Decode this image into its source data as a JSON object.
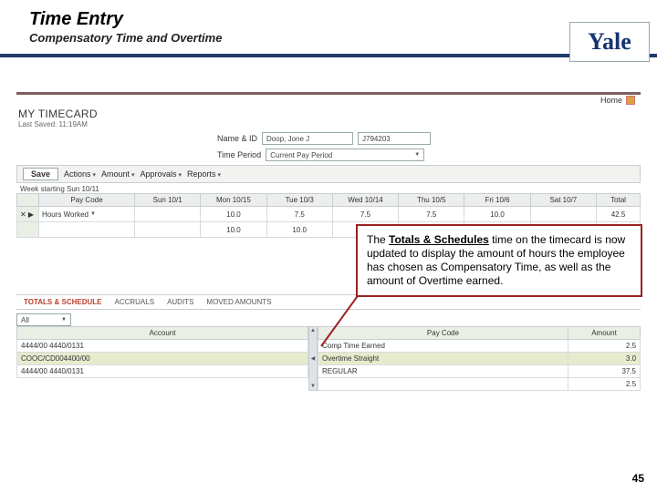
{
  "header": {
    "title": "Time Entry",
    "subtitle": "Compensatory Time and Overtime"
  },
  "brand": {
    "label": "Yale"
  },
  "corner": {
    "home": "Home"
  },
  "myTimecard": {
    "title": "MY TIMECARD",
    "saved": "Last Saved: 11:19AM"
  },
  "meta": {
    "nameLbl": "Name & ID",
    "nameVal": "Doop, Jone J",
    "idVal": "J794203",
    "periodLbl": "Time Period",
    "periodVal": "Current Pay Period"
  },
  "toolbar": {
    "save": "Save",
    "menus": [
      "Actions",
      "Amount",
      "Approvals",
      "Reports"
    ]
  },
  "week": {
    "label": "Week starting Sun 10/11"
  },
  "grid": {
    "cols": [
      "Pay Code",
      "Sun 10/1",
      "Mon 10/15",
      "Tue 10/3",
      "Wed 10/14",
      "Thu 10/5",
      "Fri 10/6",
      "Sat 10/7",
      "Total"
    ],
    "row1": [
      "Hours Worked",
      "",
      "10.0",
      "7.5",
      "7.5",
      "7.5",
      "10.0",
      "",
      "42.5"
    ],
    "row2": [
      "",
      "",
      "10.0",
      "10.0",
      "",
      "",
      "",
      "",
      ""
    ]
  },
  "callout": {
    "p1a": "The ",
    "p1b": "Totals & Schedules",
    "p1c": " time on the timecard is now updated to display the amount of hours the employee has chosen as Compensatory Time, as well as the amount of Overtime earned."
  },
  "tabs": {
    "active": "TOTALS & SCHEDULE",
    "others": [
      "ACCRUALS",
      "AUDITS",
      "MOVED AMOUNTS"
    ]
  },
  "allSel": {
    "value": "All"
  },
  "left": {
    "col": "Account",
    "rows": [
      "4444/00 4440/0131",
      "COOC/CD004400/00",
      "4444/00 4440/0131"
    ],
    "hl": 1
  },
  "right": {
    "cols": [
      "Pay Code",
      "Amount"
    ],
    "rows": [
      [
        "Comp Time Earned",
        "2.5"
      ],
      [
        "Overtime Straight",
        "3.0"
      ],
      [
        "REGULAR",
        "37.5"
      ],
      [
        "",
        "2.5"
      ]
    ],
    "hl": 1
  },
  "slideNo": "45"
}
